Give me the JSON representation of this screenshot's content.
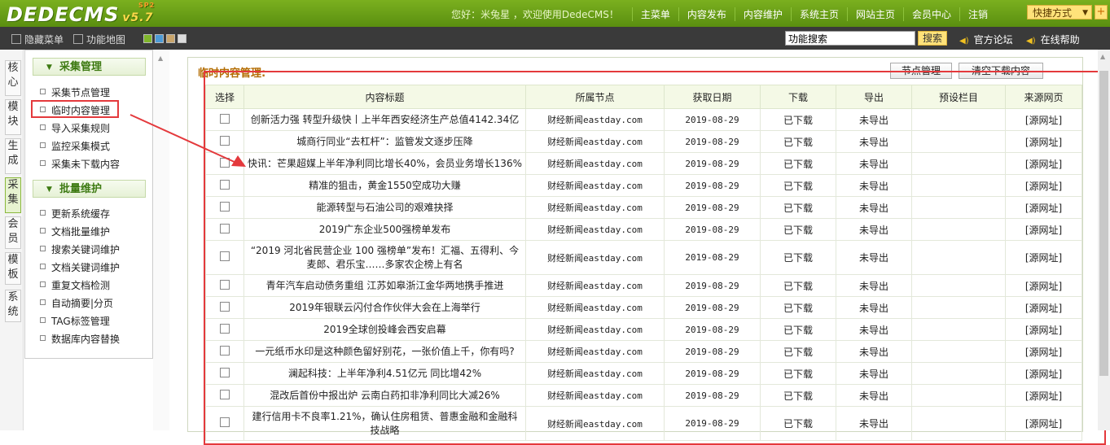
{
  "header": {
    "logo": "DEDECMS",
    "version": "v5.7",
    "version_tag": "SP2",
    "greeting": "您好：米兔星 ，欢迎使用DedeCMS！",
    "nav": [
      "主菜单",
      "内容发布",
      "内容维护",
      "系统主页",
      "网站主页",
      "会员中心",
      "注销"
    ],
    "quick": "快捷方式",
    "plus": "+"
  },
  "toolbar": {
    "hide_menu": "隐藏菜单",
    "function_map": "功能地图",
    "search_value": "功能搜索",
    "search_button": "搜索",
    "forum": "官方论坛",
    "help": "在线帮助",
    "swatch_colors": [
      "#7fb52b",
      "#4d9bd6",
      "#c9a56b",
      "#dcdcdc"
    ]
  },
  "left_tabs": [
    "核心",
    "模块",
    "生成",
    "采集",
    "会员",
    "模板",
    "系统"
  ],
  "menu": {
    "group1_title": "采集管理",
    "group1_items": [
      "采集节点管理",
      "临时内容管理",
      "导入采集规则",
      "监控采集模式",
      "采集未下载内容"
    ],
    "group2_title": "批量维护",
    "group2_items": [
      "更新系统缓存",
      "文档批量维护",
      "搜索关键词维护",
      "文档关键词维护",
      "重复文档检测",
      "自动摘要|分页",
      "TAG标签管理",
      "数据库内容替换"
    ]
  },
  "content": {
    "title": "临时内容管理:",
    "btn_nodes": "节点管理",
    "btn_clear": "清空下载内容",
    "columns": [
      "选择",
      "内容标题",
      "所属节点",
      "获取日期",
      "下载",
      "导出",
      "预设栏目",
      "来源网页"
    ],
    "rows": [
      {
        "title": "创新活力强 转型升级快丨上半年西安经济生产总值4142.34亿",
        "node": "财经新闻eastday.com",
        "date": "2019-08-29",
        "dl": "已下载",
        "ex": "未导出",
        "cat": "",
        "src": "[源网址]"
      },
      {
        "title": "城商行同业“去杠杆”：监管发文逐步压降",
        "node": "财经新闻eastday.com",
        "date": "2019-08-29",
        "dl": "已下载",
        "ex": "未导出",
        "cat": "",
        "src": "[源网址]"
      },
      {
        "title": "快讯：芒果超媒上半年净利同比增长40%，会员业务增长136%",
        "node": "财经新闻eastday.com",
        "date": "2019-08-29",
        "dl": "已下载",
        "ex": "未导出",
        "cat": "",
        "src": "[源网址]"
      },
      {
        "title": "精准的狙击，黄金1550空成功大赚",
        "node": "财经新闻eastday.com",
        "date": "2019-08-29",
        "dl": "已下载",
        "ex": "未导出",
        "cat": "",
        "src": "[源网址]"
      },
      {
        "title": "能源转型与石油公司的艰难抉择",
        "node": "财经新闻eastday.com",
        "date": "2019-08-29",
        "dl": "已下载",
        "ex": "未导出",
        "cat": "",
        "src": "[源网址]"
      },
      {
        "title": "2019广东企业500强榜单发布",
        "node": "财经新闻eastday.com",
        "date": "2019-08-29",
        "dl": "已下载",
        "ex": "未导出",
        "cat": "",
        "src": "[源网址]"
      },
      {
        "title": "“2019 河北省民营企业 100 强榜单”发布！汇福、五得利、今麦郎、君乐宝……多家农企榜上有名",
        "node": "财经新闻eastday.com",
        "date": "2019-08-29",
        "dl": "已下载",
        "ex": "未导出",
        "cat": "",
        "src": "[源网址]"
      },
      {
        "title": "青年汽车启动债务重组 江苏如皋浙江金华两地携手推进",
        "node": "财经新闻eastday.com",
        "date": "2019-08-29",
        "dl": "已下载",
        "ex": "未导出",
        "cat": "",
        "src": "[源网址]"
      },
      {
        "title": "2019年银联云闪付合作伙伴大会在上海举行",
        "node": "财经新闻eastday.com",
        "date": "2019-08-29",
        "dl": "已下载",
        "ex": "未导出",
        "cat": "",
        "src": "[源网址]"
      },
      {
        "title": "2019全球创投峰会西安启幕",
        "node": "财经新闻eastday.com",
        "date": "2019-08-29",
        "dl": "已下载",
        "ex": "未导出",
        "cat": "",
        "src": "[源网址]"
      },
      {
        "title": "一元纸币水印是这种颜色留好别花，一张价值上千，你有吗?",
        "node": "财经新闻eastday.com",
        "date": "2019-08-29",
        "dl": "已下载",
        "ex": "未导出",
        "cat": "",
        "src": "[源网址]"
      },
      {
        "title": "澜起科技：上半年净利4.51亿元 同比增42%",
        "node": "财经新闻eastday.com",
        "date": "2019-08-29",
        "dl": "已下载",
        "ex": "未导出",
        "cat": "",
        "src": "[源网址]"
      },
      {
        "title": "混改后首份中报出炉 云南白药扣非净利同比大减26%",
        "node": "财经新闻eastday.com",
        "date": "2019-08-29",
        "dl": "已下载",
        "ex": "未导出",
        "cat": "",
        "src": "[源网址]"
      },
      {
        "title": "建行信用卡不良率1.21%，确认住房租赁、普惠金融和金融科技战略",
        "node": "财经新闻eastday.com",
        "date": "2019-08-29",
        "dl": "已下载",
        "ex": "未导出",
        "cat": "",
        "src": "[源网址]"
      }
    ]
  }
}
